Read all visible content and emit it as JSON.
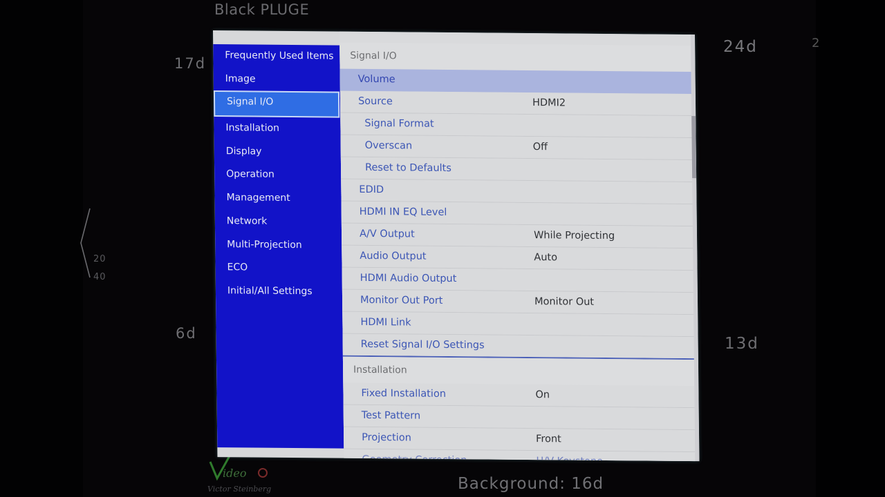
{
  "background": {
    "title": "Black PLUGE",
    "labels": {
      "top_left": "17d",
      "top_right": "24d",
      "mid_left": "6d",
      "mid_right": "13d",
      "tick_20": "20",
      "tick_40": "40",
      "footer": "Background: 16d"
    },
    "logo": {
      "text": "VideoQ",
      "author": "Victor Steinberg"
    }
  },
  "menu": {
    "nav": {
      "items": [
        {
          "label": "Frequently Used Items",
          "active": false
        },
        {
          "label": "Image",
          "active": false
        },
        {
          "label": "Signal I/O",
          "active": true
        },
        {
          "label": "Installation",
          "active": false
        },
        {
          "label": "Display",
          "active": false
        },
        {
          "label": "Operation",
          "active": false
        },
        {
          "label": "Management",
          "active": false
        },
        {
          "label": "Network",
          "active": false
        },
        {
          "label": "Multi-Projection",
          "active": false
        },
        {
          "label": "ECO",
          "active": false
        },
        {
          "label": "Initial/All Settings",
          "active": false
        }
      ]
    },
    "sections": [
      {
        "header": "Signal I/O",
        "rows": [
          {
            "label": "Volume",
            "value": "",
            "selected": true,
            "sub": false
          },
          {
            "label": "Source",
            "value": "HDMI2",
            "selected": false,
            "sub": false
          },
          {
            "label": "Signal Format",
            "value": "",
            "selected": false,
            "sub": true
          },
          {
            "label": "Overscan",
            "value": "Off",
            "selected": false,
            "sub": true
          },
          {
            "label": "Reset to Defaults",
            "value": "",
            "selected": false,
            "sub": true
          },
          {
            "label": "EDID",
            "value": "",
            "selected": false,
            "sub": false
          },
          {
            "label": "HDMI IN EQ Level",
            "value": "",
            "selected": false,
            "sub": false
          },
          {
            "label": "A/V Output",
            "value": "While Projecting",
            "selected": false,
            "sub": false
          },
          {
            "label": "Audio Output",
            "value": "Auto",
            "selected": false,
            "sub": false
          },
          {
            "label": "HDMI Audio Output",
            "value": "",
            "selected": false,
            "sub": false
          },
          {
            "label": "Monitor Out Port",
            "value": "Monitor Out",
            "selected": false,
            "sub": false
          },
          {
            "label": "HDMI Link",
            "value": "",
            "selected": false,
            "sub": false
          },
          {
            "label": "Reset Signal I/O Settings",
            "value": "",
            "selected": false,
            "sub": false
          }
        ]
      },
      {
        "header": "Installation",
        "rows": [
          {
            "label": "Fixed Installation",
            "value": "On",
            "selected": false,
            "sub": false
          },
          {
            "label": "Test Pattern",
            "value": "",
            "selected": false,
            "sub": false
          },
          {
            "label": "Projection",
            "value": "Front",
            "selected": false,
            "sub": false
          },
          {
            "label": "Geometry Correction",
            "value": "H/V-Keystone",
            "selected": false,
            "sub": false
          }
        ]
      }
    ],
    "scrollbar": {
      "position_fraction": 0.2
    }
  },
  "colors": {
    "nav_bg": "#1213c8",
    "nav_active": "#2f6de4",
    "content_bg": "#d9dadc",
    "selected_row": "#aab4de",
    "label_text": "#3c56b5",
    "value_text": "#303236"
  }
}
